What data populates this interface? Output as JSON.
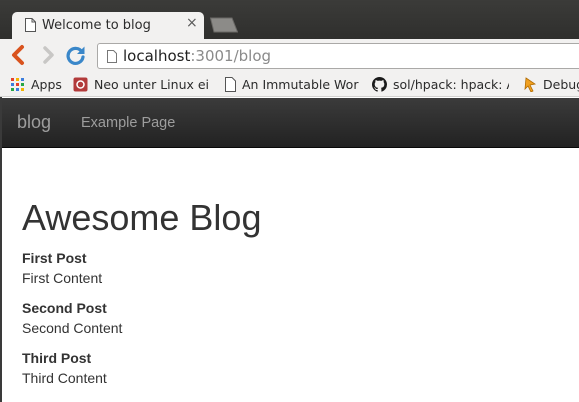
{
  "browser": {
    "tab": {
      "title": "Welcome to blog",
      "close_glyph": "×",
      "icon": "page-icon"
    },
    "new_tab_icon": "new-tab-icon",
    "toolbar": {
      "back_icon": "back-icon",
      "forward_icon": "forward-icon",
      "reload_icon": "reload-icon",
      "url_host": "localhost",
      "url_rest": ":3001/blog"
    },
    "bookmarks": [
      {
        "label": "Apps",
        "icon": "apps-grid-icon"
      },
      {
        "label": "Neo unter Linux ein",
        "icon": "neo-icon"
      },
      {
        "label": "An Immutable Worl",
        "icon": "page-icon"
      },
      {
        "label": "sol/hpack: hpack: A",
        "icon": "github-icon"
      },
      {
        "label": "Debug",
        "icon": "debug-icon"
      }
    ]
  },
  "site": {
    "navbar": {
      "brand": "blog",
      "link": "Example Page",
      "bg": "#222222",
      "text_color": "#9d9d9d"
    },
    "title": "Awesome Blog",
    "posts": [
      {
        "title": "First Post",
        "body": "First Content"
      },
      {
        "title": "Second Post",
        "body": "Second Content"
      },
      {
        "title": "Third Post",
        "body": "Third Content"
      }
    ]
  }
}
